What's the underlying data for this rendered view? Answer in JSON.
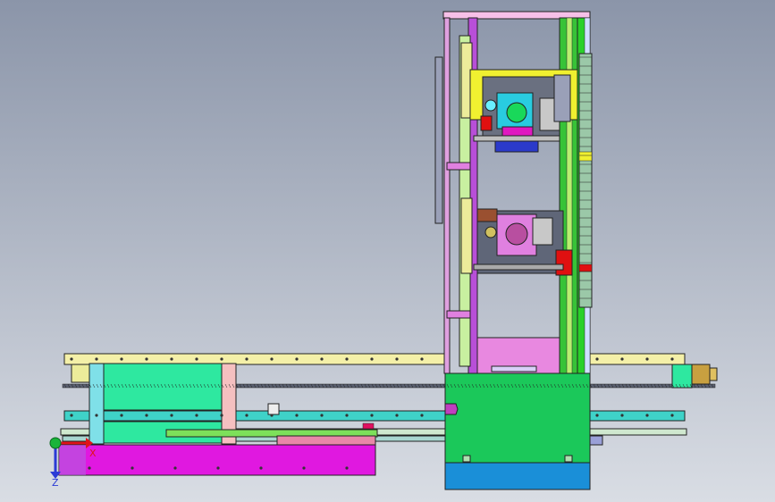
{
  "viewport": {
    "background_top": "#8b95a9",
    "background_bottom": "#d9dde4"
  },
  "triad": {
    "x_label": "X",
    "z_label": "Z",
    "x_color": "#e0141a",
    "z_color": "#2a3ad6",
    "y_color": "#19b43a"
  },
  "colors": {
    "rail_yellow": "#f4f0a8",
    "rail_cyan": "#3fd2c8",
    "rail_green": "#3fbf3f",
    "carriage_green": "#1bc85a",
    "base_blue": "#1a8fd8",
    "base_magenta": "#e018e0",
    "pink": "#f2a0c0",
    "column_purple": "#b84fd8",
    "column_green": "#37c337",
    "head_yellow": "#f0f030",
    "head_blue": "#2b3acb",
    "head_cyan": "#29cce0",
    "head_red": "#e01010",
    "teal_block": "#2ee8a0",
    "chain_lime": "#7de05a",
    "plate_violet": "#e888e0",
    "steel_gray": "#6a7080"
  }
}
